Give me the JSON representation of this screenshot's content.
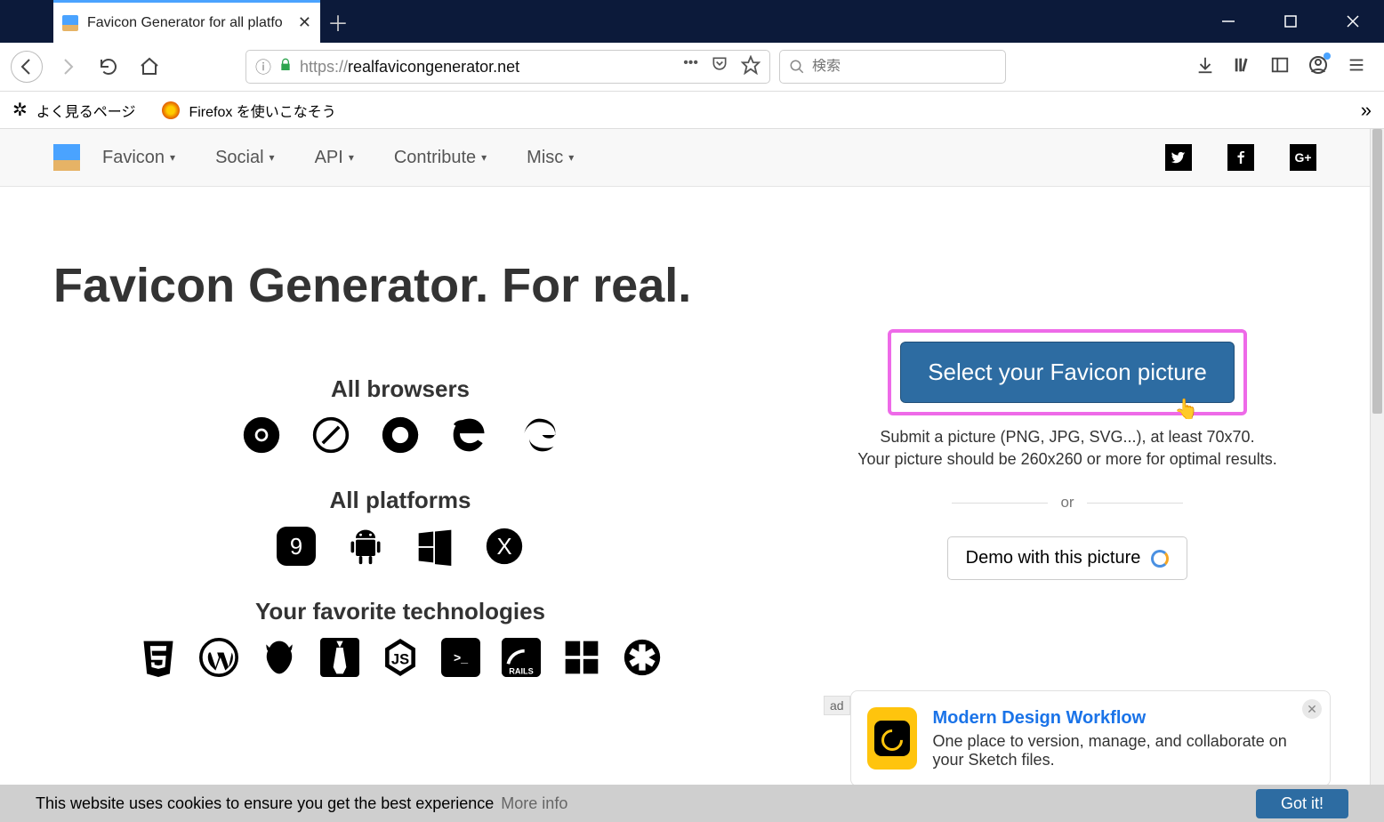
{
  "browser": {
    "tab_title": "Favicon Generator for all platfo",
    "url_scheme": "https://",
    "url_host": "realfavicongenerator.net",
    "search_placeholder": "検索"
  },
  "bookmarks": {
    "item1": "よく見るページ",
    "item2": "Firefox を使いこなそう"
  },
  "nav": {
    "items": [
      "Favicon",
      "Social",
      "API",
      "Contribute",
      "Misc"
    ]
  },
  "page": {
    "title": "Favicon Generator. For real.",
    "section_browsers": "All browsers",
    "section_platforms": "All platforms",
    "section_tech": "Your favorite technologies",
    "select_button": "Select your Favicon picture",
    "hint1": "Submit a picture (PNG, JPG, SVG...), at least 70x70.",
    "hint2": "Your picture should be 260x260 or more for optimal results.",
    "or": "or",
    "demo_button": "Demo with this picture"
  },
  "ad": {
    "label": "ad",
    "title": "Modern Design Workflow",
    "body": "One place to version, manage, and collaborate on your Sketch files."
  },
  "cookie": {
    "msg": "This website uses cookies to ensure you get the best experience",
    "more": "More info",
    "gotit": "Got it!"
  }
}
